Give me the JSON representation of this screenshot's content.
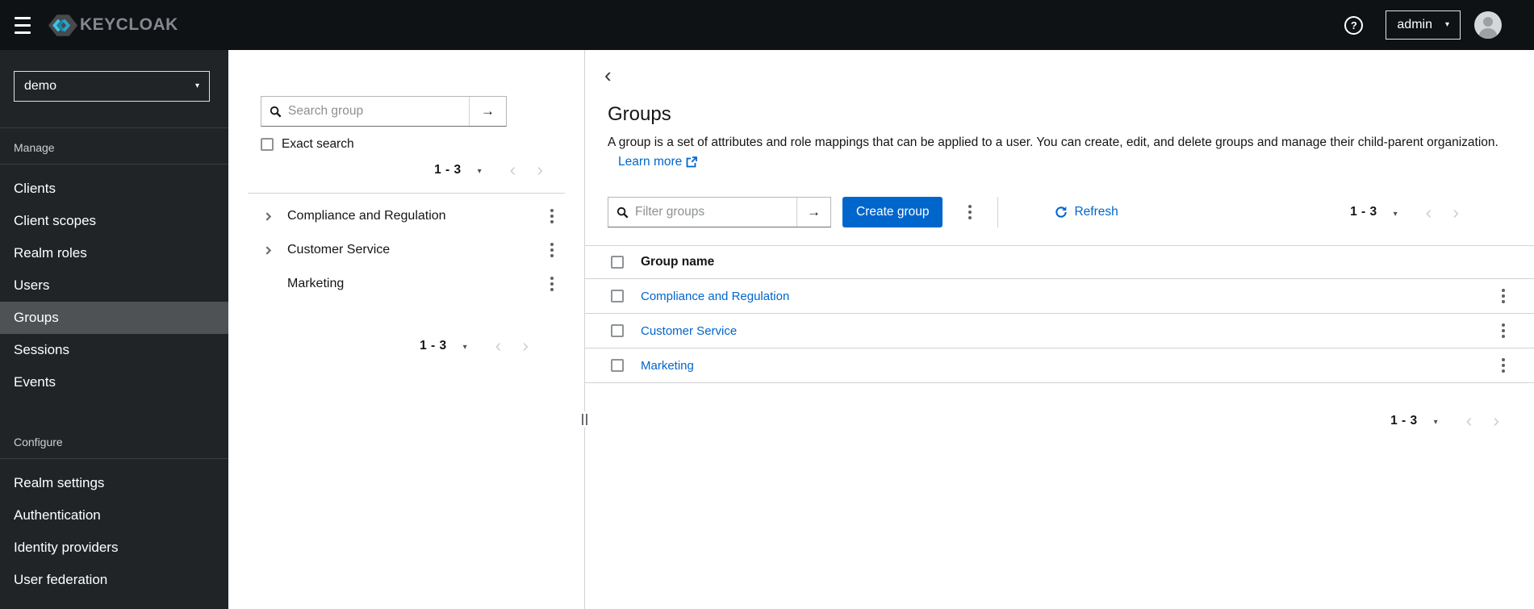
{
  "masthead": {
    "brand": "KEYCLOAK",
    "user_menu": "admin"
  },
  "sidebar": {
    "realm_selector": {
      "value": "demo"
    },
    "sections": [
      {
        "label": "Manage",
        "items": [
          {
            "label": "Clients"
          },
          {
            "label": "Client scopes"
          },
          {
            "label": "Realm roles"
          },
          {
            "label": "Users"
          },
          {
            "label": "Groups",
            "selected": true
          },
          {
            "label": "Sessions"
          },
          {
            "label": "Events"
          }
        ]
      },
      {
        "label": "Configure",
        "items": [
          {
            "label": "Realm settings"
          },
          {
            "label": "Authentication"
          },
          {
            "label": "Identity providers"
          },
          {
            "label": "User federation"
          }
        ]
      }
    ]
  },
  "tree_panel": {
    "search_placeholder": "Search group",
    "exact_search_label": "Exact search",
    "pagination_top": "1 - 3",
    "pagination_bottom": "1 - 3",
    "items": [
      {
        "label": "Compliance and Regulation",
        "expandable": true
      },
      {
        "label": "Customer Service",
        "expandable": true
      },
      {
        "label": "Marketing",
        "expandable": false
      }
    ]
  },
  "main": {
    "title": "Groups",
    "description": "A group is a set of attributes and role mappings that can be applied to a user. You can create, edit, and delete groups and manage their child-parent organization.",
    "learn_more_label": "Learn more",
    "toolbar": {
      "filter_placeholder": "Filter groups",
      "create_button": "Create group",
      "refresh_label": "Refresh",
      "pagination_range": "1 - 3"
    },
    "table": {
      "columns": [
        "Group name"
      ],
      "rows": [
        {
          "name": "Compliance and Regulation"
        },
        {
          "name": "Customer Service"
        },
        {
          "name": "Marketing"
        }
      ]
    },
    "pagination_bottom": "1 - 3"
  },
  "icons": {
    "help": "?",
    "caret": "▾",
    "prev": "‹",
    "next": "›",
    "back": "‹",
    "submit_arrow": "→"
  },
  "colors": {
    "primary_blue": "#0066cc",
    "link_blue": "#0066cc",
    "masthead_bg": "#0f1214",
    "sidebar_bg": "#212427",
    "sidebar_selected_bg": "#4f5255",
    "logo_cyan": "#3cc5e8",
    "border_gray": "#d2d2d2"
  }
}
